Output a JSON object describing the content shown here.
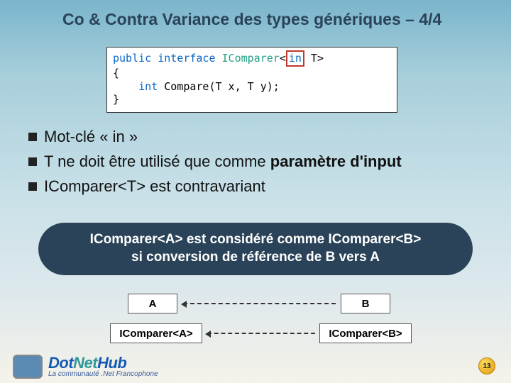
{
  "title": "Co & Contra Variance des types génériques – 4/4",
  "code": {
    "l1_kw": "public interface",
    "l1_type": " IComparer",
    "l1_open": "<",
    "l1_in": "in",
    "l1_tail": " T>",
    "l2": "{",
    "l3_kw": "    int",
    "l3_rest": " Compare(T x, T y);",
    "l4": "}"
  },
  "bullets": {
    "b1": "Mot-clé « in »",
    "b2_a": "T ne doit être utilisé que comme ",
    "b2_b": "paramètre d'input",
    "b3": "IComparer<T> est contravariant"
  },
  "callout": {
    "l1_a": "IComparer<A>",
    "l1_b": " est considéré comme ",
    "l1_c": "IComparer<B>",
    "l2_a": "si conversion de référence de ",
    "l2_b": "B vers A"
  },
  "diagram": {
    "A": "A",
    "B": "B",
    "ICA": "IComparer<A>",
    "ICB": "IComparer<B>"
  },
  "logo": {
    "dot": "Dot",
    "net": "Net",
    "hub": "Hub",
    "tag": "La communauté .Net Francophone"
  },
  "page": "13"
}
